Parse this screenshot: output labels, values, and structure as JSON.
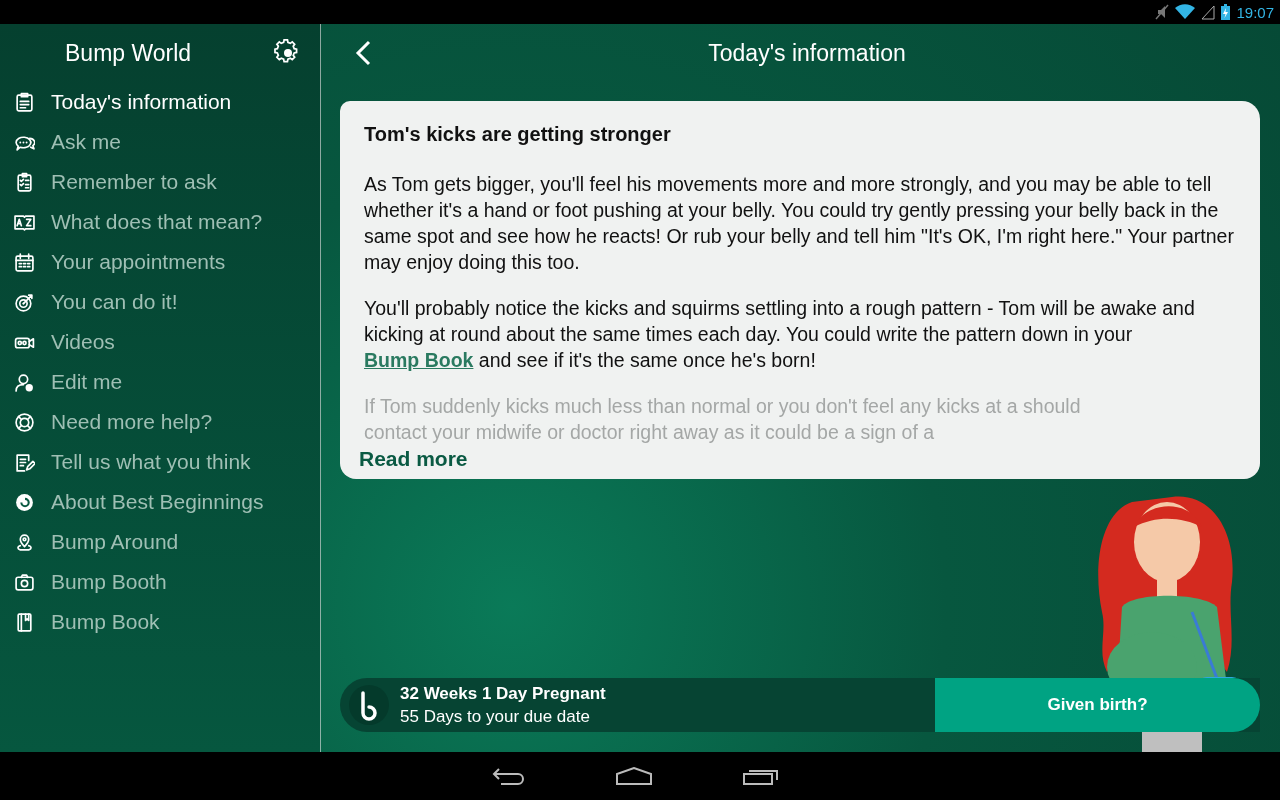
{
  "status_bar": {
    "time": "19:07"
  },
  "sidebar": {
    "title": "Bump World",
    "items": [
      {
        "label": "Today's information",
        "selected": true
      },
      {
        "label": "Ask me",
        "selected": false
      },
      {
        "label": "Remember to ask",
        "selected": false
      },
      {
        "label": "What does that mean?",
        "selected": false
      },
      {
        "label": "Your appointments",
        "selected": false
      },
      {
        "label": "You can do it!",
        "selected": false
      },
      {
        "label": "Videos",
        "selected": false
      },
      {
        "label": "Edit me",
        "selected": false
      },
      {
        "label": "Need more help?",
        "selected": false
      },
      {
        "label": "Tell us what you think",
        "selected": false
      },
      {
        "label": "About Best Beginnings",
        "selected": false
      },
      {
        "label": "Bump Around",
        "selected": false
      },
      {
        "label": "Bump Booth",
        "selected": false
      },
      {
        "label": "Bump Book",
        "selected": false
      }
    ]
  },
  "header": {
    "title": "Today's information"
  },
  "card": {
    "heading": "Tom's kicks are getting stronger",
    "paragraphs": [
      {
        "text": "As Tom gets bigger, you'll feel his movements more and more strongly, and you may be able to tell whether it's a hand or foot pushing at your belly. You could try gently pressing your belly back in the same spot and see how he reacts! Or rub your belly and tell him \"It's OK, I'm right here.\" Your partner may enjoy doing this too."
      },
      {
        "text": "You'll probably notice the kicks and squirms settling into a rough pattern - Tom will be awake and kicking at round about the same times each day. You could write the pattern down in your ",
        "link": "Bump Book",
        "after": " and see if it's the same once he's born!"
      }
    ],
    "faded_text": "If Tom suddenly kicks much less than normal or you don't feel any kicks at a should contact your midwife or doctor right away as it could be a sign of a",
    "read_more": "Read more"
  },
  "progress": {
    "weeks": "32 Weeks 1 Day Pregnant",
    "due": "55 Days to your due date",
    "button": "Given birth?"
  }
}
